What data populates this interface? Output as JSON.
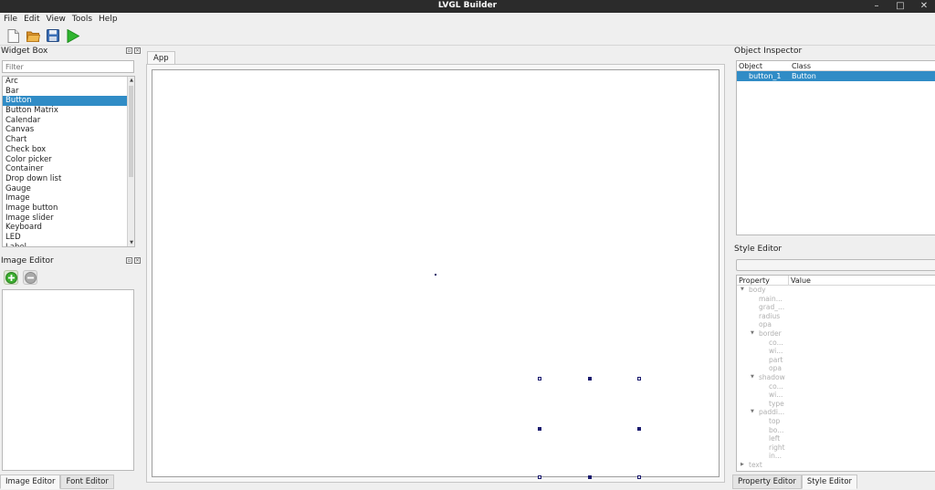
{
  "window": {
    "title": "LVGL Builder",
    "controls": [
      "–",
      "□",
      "✕"
    ]
  },
  "menu": [
    "File",
    "Edit",
    "View",
    "Tools",
    "Help"
  ],
  "toolbar": {
    "icons": [
      "new-file-icon",
      "open-folder-icon",
      "save-icon",
      "run-icon"
    ],
    "colors": {
      "run": "#2fb52f",
      "folder": "#e8a73a",
      "save": "#3b6fb6"
    }
  },
  "widget_box": {
    "title": "Widget Box",
    "filter_placeholder": "Filter",
    "items": [
      "Arc",
      "Bar",
      "Button",
      "Button Matrix",
      "Calendar",
      "Canvas",
      "Chart",
      "Check box",
      "Color picker",
      "Container",
      "Drop down list",
      "Gauge",
      "Image",
      "Image button",
      "Image slider",
      "Keyboard",
      "LED",
      "Label"
    ],
    "selected": "Button"
  },
  "image_editor": {
    "title": "Image Editor",
    "tabs": [
      "Image Editor",
      "Font Editor"
    ],
    "active_tab": "Image Editor"
  },
  "center": {
    "tab": "App"
  },
  "object_inspector": {
    "title": "Object Inspector",
    "columns": [
      "Object",
      "Class"
    ],
    "rows": [
      {
        "object": "button_1",
        "class": "Button"
      }
    ]
  },
  "style_editor": {
    "title": "Style Editor",
    "columns": [
      "Property",
      "Value"
    ],
    "tree": [
      {
        "label": "body",
        "level": 0,
        "expanded": true
      },
      {
        "label": "main...",
        "level": 1
      },
      {
        "label": "grad_...",
        "level": 1
      },
      {
        "label": "radius",
        "level": 1
      },
      {
        "label": "opa",
        "level": 1
      },
      {
        "label": "border",
        "level": 1,
        "expanded": true
      },
      {
        "label": "co...",
        "level": 2
      },
      {
        "label": "wi...",
        "level": 2
      },
      {
        "label": "part",
        "level": 2
      },
      {
        "label": "opa",
        "level": 2
      },
      {
        "label": "shadow",
        "level": 1,
        "expanded": true
      },
      {
        "label": "co...",
        "level": 2
      },
      {
        "label": "wi...",
        "level": 2
      },
      {
        "label": "type",
        "level": 2
      },
      {
        "label": "paddi...",
        "level": 1,
        "expanded": true
      },
      {
        "label": "top",
        "level": 2
      },
      {
        "label": "bo...",
        "level": 2
      },
      {
        "label": "left",
        "level": 2
      },
      {
        "label": "right",
        "level": 2
      },
      {
        "label": "in...",
        "level": 2
      },
      {
        "label": "text",
        "level": 0,
        "expanded": false
      }
    ],
    "tabs": [
      "Property Editor",
      "Style Editor"
    ],
    "active_tab": "Style Editor"
  },
  "colors": {
    "selection": "#308cc6",
    "titlebar": "#2b2b2b"
  }
}
